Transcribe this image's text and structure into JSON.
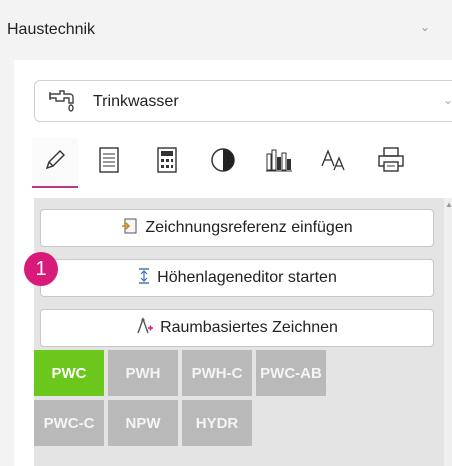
{
  "header": {
    "title": "Haustechnik"
  },
  "system_dropdown": {
    "value": "Trinkwasser"
  },
  "tabs": [
    {
      "name": "pencil-icon",
      "active": true
    },
    {
      "name": "list-icon",
      "active": false
    },
    {
      "name": "calculator-icon",
      "active": false
    },
    {
      "name": "pie-chart-icon",
      "active": false
    },
    {
      "name": "bar-chart-icon",
      "active": false
    },
    {
      "name": "text-size-icon",
      "active": false
    },
    {
      "name": "printer-icon",
      "active": false
    }
  ],
  "actions": {
    "insert_reference": "Zeichnungsreferenz einfügen",
    "height_editor": "Höhenlageneditor starten",
    "room_drawing": "Raumbasiertes Zeichnen"
  },
  "callout_badge": "1",
  "systems": [
    "PWC",
    "PWH",
    "PWH-C",
    "PWC-AB",
    "PWC-C",
    "NPW",
    "HYDR"
  ],
  "active_system": "PWC",
  "colors": {
    "accent": "#c0348a",
    "badge": "#d81b7a",
    "active_chip": "#6cc71d",
    "chip": "#b9b9b9"
  }
}
